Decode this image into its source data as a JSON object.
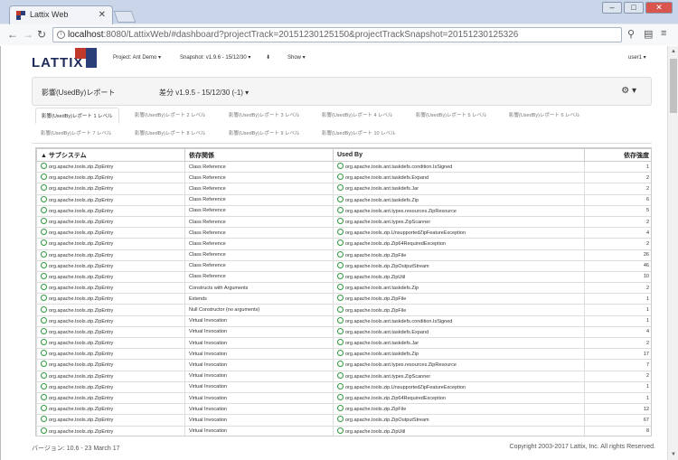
{
  "browser": {
    "tab_title": "Lattix Web",
    "url_host": "localhost",
    "url_rest": ":8080/LattixWeb/#dashboard?projectTrack=20151230125150&projectTrackSnapshot=20151230125326"
  },
  "app": {
    "logo_text": "LATTIX",
    "project_menu": "Project: Ant Demo ▾",
    "snapshot_menu": "Snapshot: v1.9.6 - 15/12/30 ▾",
    "download_icon": "⬇",
    "show_menu": "Show ▾",
    "user_menu": "user1 ▾"
  },
  "report": {
    "title": "影響(UsedBy)レポート",
    "diff_selector": "差分 v1.9.5 - 15/12/30 (-1) ▾",
    "settings_icon": "⚙ ▾"
  },
  "level_tabs": [
    "影響(UsedBy)レポート 1 レベル",
    "影響(UsedBy)レポート 2 レベル",
    "影響(UsedBy)レポート 3 レベル",
    "影響(UsedBy)レポート 4 レベル",
    "影響(UsedBy)レポート 5 レベル",
    "影響(UsedBy)レポート 6 レベル",
    "影響(UsedBy)レポート 7 レベル",
    "影響(UsedBy)レポート 8 レベル",
    "影響(UsedBy)レポート 9 レベル",
    "影響(UsedBy)レポート 10 レベル"
  ],
  "table": {
    "columns": [
      "▲ サブシステム",
      "依存関係",
      "Used By",
      "依存強度"
    ],
    "rows": [
      [
        "org.apache.tools.zip.ZipEntry",
        "Class Reference",
        "org.apache.tools.ant.taskdefs.condition.IsSigned",
        "1"
      ],
      [
        "org.apache.tools.zip.ZipEntry",
        "Class Reference",
        "org.apache.tools.ant.taskdefs.Expand",
        "2"
      ],
      [
        "org.apache.tools.zip.ZipEntry",
        "Class Reference",
        "org.apache.tools.ant.taskdefs.Jar",
        "2"
      ],
      [
        "org.apache.tools.zip.ZipEntry",
        "Class Reference",
        "org.apache.tools.ant.taskdefs.Zip",
        "6"
      ],
      [
        "org.apache.tools.zip.ZipEntry",
        "Class Reference",
        "org.apache.tools.ant.types.resources.ZipResource",
        "5"
      ],
      [
        "org.apache.tools.zip.ZipEntry",
        "Class Reference",
        "org.apache.tools.ant.types.ZipScanner",
        "2"
      ],
      [
        "org.apache.tools.zip.ZipEntry",
        "Class Reference",
        "org.apache.tools.zip.UnsupportedZipFeatureException",
        "4"
      ],
      [
        "org.apache.tools.zip.ZipEntry",
        "Class Reference",
        "org.apache.tools.zip.Zip64RequiredException",
        "2"
      ],
      [
        "org.apache.tools.zip.ZipEntry",
        "Class Reference",
        "org.apache.tools.zip.ZipFile",
        "26"
      ],
      [
        "org.apache.tools.zip.ZipEntry",
        "Class Reference",
        "org.apache.tools.zip.ZipOutputStream",
        "46"
      ],
      [
        "org.apache.tools.zip.ZipEntry",
        "Class Reference",
        "org.apache.tools.zip.ZipUtil",
        "10"
      ],
      [
        "org.apache.tools.zip.ZipEntry",
        "Constructs with Arguments",
        "org.apache.tools.ant.taskdefs.Zip",
        "2"
      ],
      [
        "org.apache.tools.zip.ZipEntry",
        "Extends",
        "org.apache.tools.zip.ZipFile",
        "1"
      ],
      [
        "org.apache.tools.zip.ZipEntry",
        "Null Constructor (no arguments)",
        "org.apache.tools.zip.ZipFile",
        "1"
      ],
      [
        "org.apache.tools.zip.ZipEntry",
        "Virtual Invocation",
        "org.apache.tools.ant.taskdefs.condition.IsSigned",
        "1"
      ],
      [
        "org.apache.tools.zip.ZipEntry",
        "Virtual Invocation",
        "org.apache.tools.ant.taskdefs.Expand",
        "4"
      ],
      [
        "org.apache.tools.zip.ZipEntry",
        "Virtual Invocation",
        "org.apache.tools.ant.taskdefs.Jar",
        "2"
      ],
      [
        "org.apache.tools.zip.ZipEntry",
        "Virtual Invocation",
        "org.apache.tools.ant.taskdefs.Zip",
        "17"
      ],
      [
        "org.apache.tools.zip.ZipEntry",
        "Virtual Invocation",
        "org.apache.tools.ant.types.resources.ZipResource",
        "7"
      ],
      [
        "org.apache.tools.zip.ZipEntry",
        "Virtual Invocation",
        "org.apache.tools.ant.types.ZipScanner",
        "2"
      ],
      [
        "org.apache.tools.zip.ZipEntry",
        "Virtual Invocation",
        "org.apache.tools.zip.UnsupportedZipFeatureException",
        "1"
      ],
      [
        "org.apache.tools.zip.ZipEntry",
        "Virtual Invocation",
        "org.apache.tools.zip.Zip64RequiredException",
        "1"
      ],
      [
        "org.apache.tools.zip.ZipEntry",
        "Virtual Invocation",
        "org.apache.tools.zip.ZipFile",
        "12"
      ],
      [
        "org.apache.tools.zip.ZipEntry",
        "Virtual Invocation",
        "org.apache.tools.zip.ZipOutputStream",
        "67"
      ],
      [
        "org.apache.tools.zip.ZipEntry",
        "Virtual Invocation",
        "org.apache.tools.zip.ZipUtil",
        "8"
      ]
    ]
  },
  "footer": {
    "version": "バージョン: 10.6 - 23 March 17",
    "copyright": "Copyright 2003-2017 Lattix, Inc. All rights Reserved."
  },
  "colors": {
    "dependency_icon": "#2e9b3e",
    "logo_red": "#c0392b",
    "logo_navy": "#2c3e7a"
  }
}
